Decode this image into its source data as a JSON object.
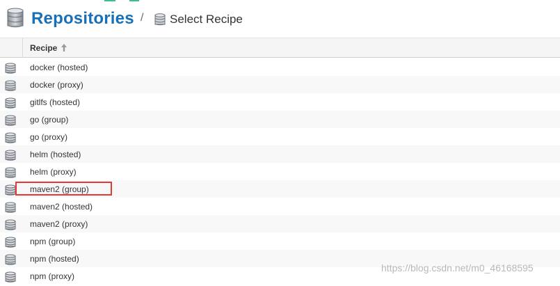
{
  "header": {
    "title": "Repositories",
    "separator": "/",
    "subtitle": "Select Recipe",
    "title_icon": "database-icon",
    "subtitle_icon": "database-icon",
    "title_color": "#1770b8"
  },
  "table": {
    "column_header": "Recipe",
    "sort_icon": "arrow-up-icon",
    "row_icon": "database-icon",
    "rows": [
      {
        "label": "docker (hosted)"
      },
      {
        "label": "docker (proxy)"
      },
      {
        "label": "gitlfs (hosted)"
      },
      {
        "label": "go (group)"
      },
      {
        "label": "go (proxy)"
      },
      {
        "label": "helm (hosted)"
      },
      {
        "label": "helm (proxy)"
      },
      {
        "label": "maven2 (group)",
        "highlighted": true
      },
      {
        "label": "maven2 (hosted)"
      },
      {
        "label": "maven2 (proxy)"
      },
      {
        "label": "npm (group)"
      },
      {
        "label": "npm (hosted)"
      },
      {
        "label": "npm (proxy)"
      }
    ],
    "highlight_color": "#e53935"
  },
  "watermark": "https://blog.csdn.net/m0_46168595"
}
